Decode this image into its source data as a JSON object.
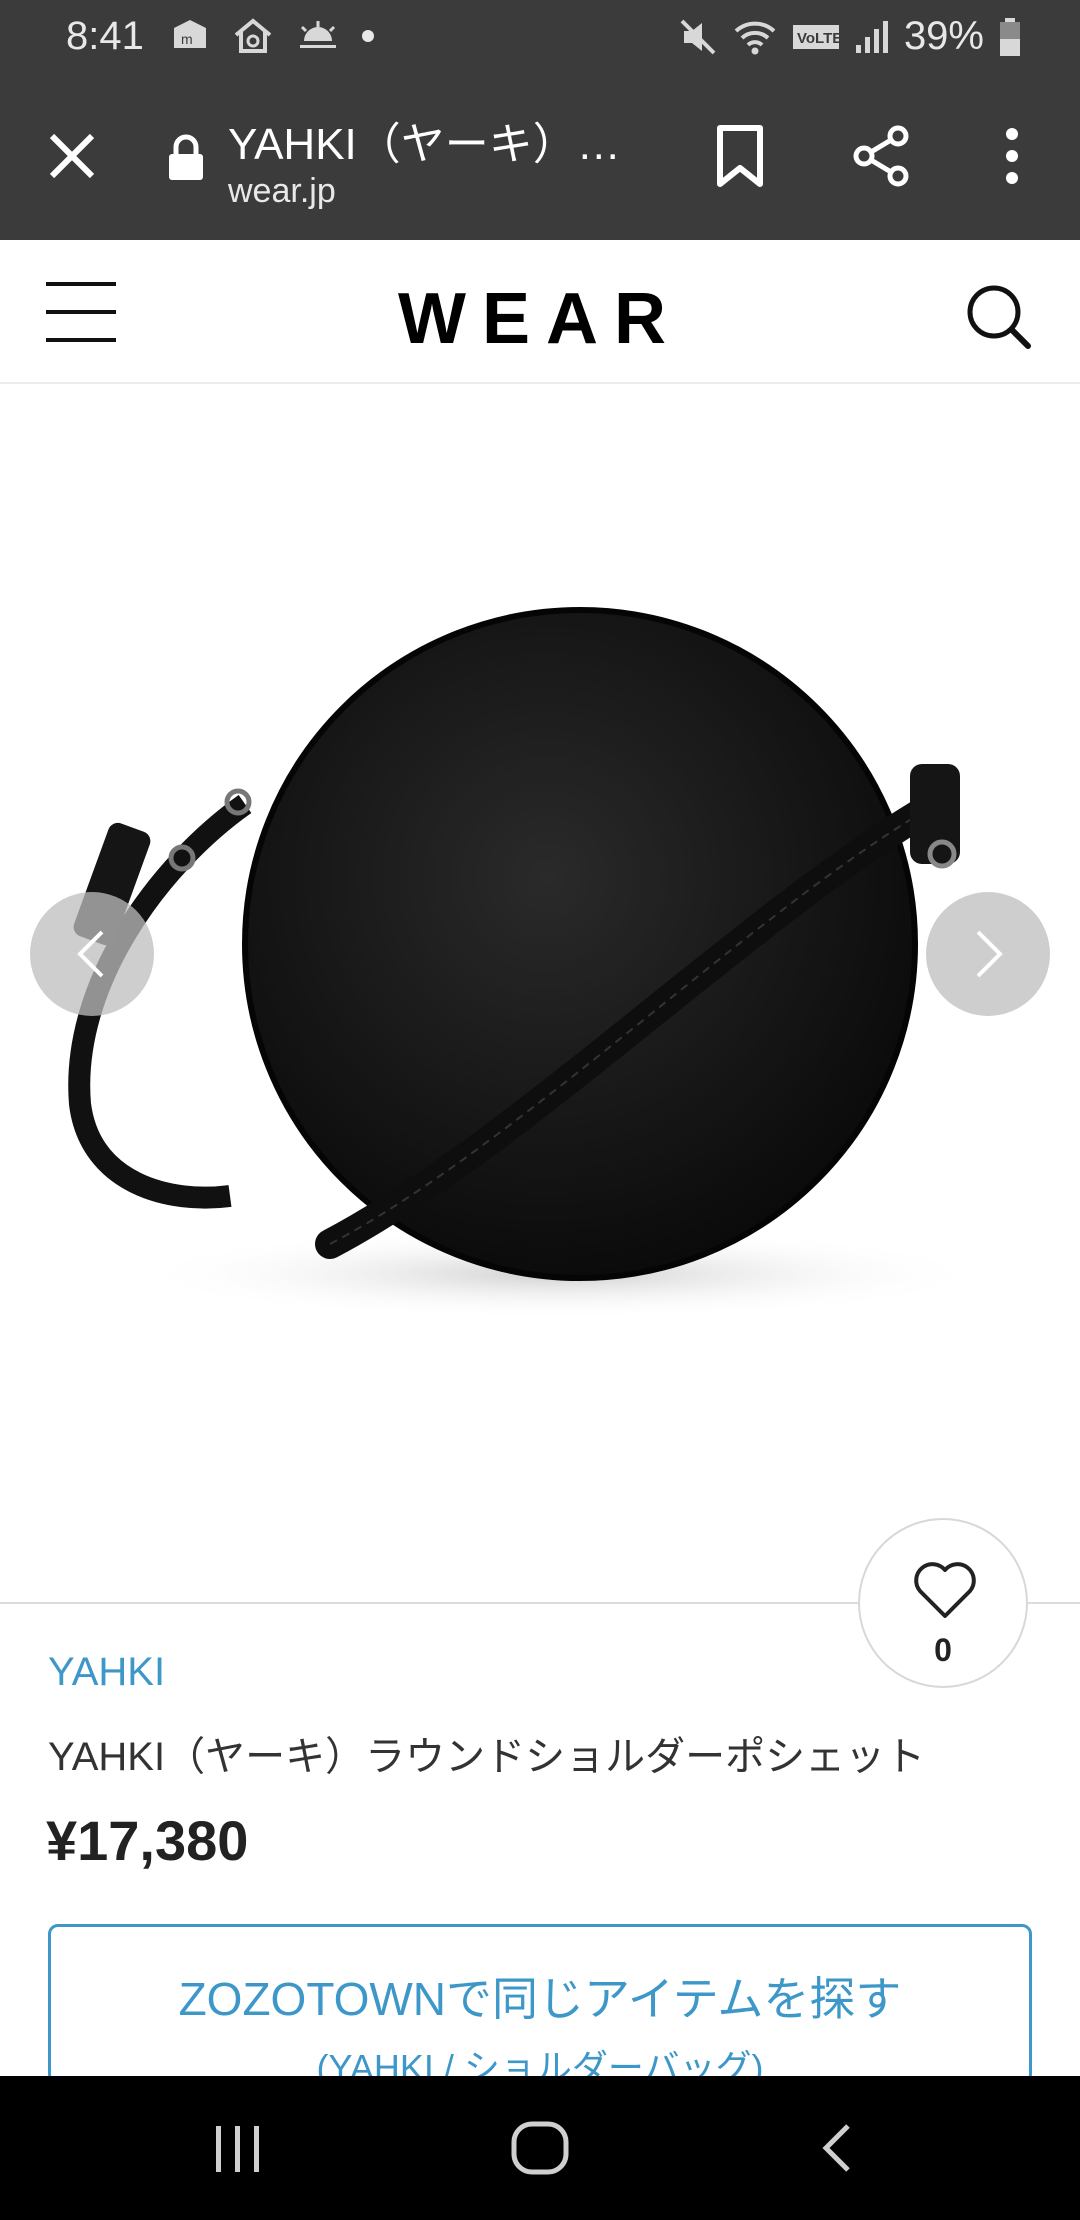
{
  "status_bar": {
    "time": "8:41",
    "battery": "39%",
    "left_icons": [
      "mobile-data-icon",
      "home-sync-icon",
      "weather-icon",
      "notification-dot-icon"
    ],
    "right_icons": [
      "mute-icon",
      "wifi-icon",
      "volte-icon",
      "signal-icon",
      "battery-icon"
    ]
  },
  "browser": {
    "title": "YAHKI（ヤーキ）…",
    "url": "wear.jp"
  },
  "site": {
    "logo": "WEAR"
  },
  "product": {
    "like_count": "0",
    "brand": "YAHKI",
    "name": "YAHKI（ヤーキ）ラウンドショルダーポシェット",
    "price": "¥17,380"
  },
  "zozo_button": {
    "label": "ZOZOTOWNで同じアイテムを探す",
    "sub_label": "(YAHKI / ショルダーバッグ)"
  },
  "colors": {
    "chrome_bg": "#3b3b3b",
    "accent": "#3d97c8",
    "navbar_bg": "#000000"
  }
}
